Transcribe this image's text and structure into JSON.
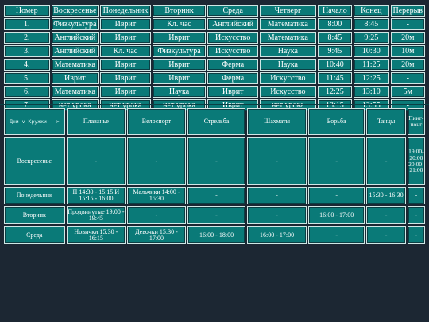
{
  "schedule": {
    "headers": [
      "Номер",
      "Воскресенье",
      "Понедельник",
      "Вторник",
      "Среда",
      "Четверг",
      "Начало",
      "Конец",
      "Перерыв"
    ],
    "rows": [
      [
        "1.",
        "Физкультура",
        "Иврит",
        "Кл. час",
        "Английский",
        "Математика",
        "8:00",
        "8:45",
        "-"
      ],
      [
        "2.",
        "Английский",
        "Иврит",
        "Иврит",
        "Искусство",
        "Математика",
        "8:45",
        "9:25",
        "20м"
      ],
      [
        "3.",
        "Английский",
        "Кл. час",
        "Физкультура",
        "Искусство",
        "Наука",
        "9:45",
        "10:30",
        "10м"
      ],
      [
        "4.",
        "Математика",
        "Иврит",
        "Иврит",
        "Ферма",
        "Наука",
        "10:40",
        "11:25",
        "20м"
      ],
      [
        "5.",
        "Иврит",
        "Иврит",
        "Иврит",
        "Ферма",
        "Искусство",
        "11:45",
        "12:25",
        "-"
      ],
      [
        "6.",
        "Математика",
        "Иврит",
        "Наука",
        "Иврит",
        "Искусство",
        "12:25",
        "13:10",
        "5м"
      ],
      [
        "7.",
        "нет урока",
        "нет урока",
        "нет урока",
        "Иврит",
        "нет урока",
        "13:15",
        "13:55",
        "-"
      ]
    ]
  },
  "clubs": {
    "corner": "Дни v Кружки -->",
    "headers": [
      "Плаванье",
      "Велоспорт",
      "Стрельба",
      "Шахматы",
      "Борьба",
      "Танцы",
      "Пинг-понг"
    ],
    "rows": [
      {
        "day": "Воскресенье",
        "cells": [
          "-",
          "-",
          "-",
          "-",
          "-",
          "-",
          "19:00-20:00 20:00-21:00"
        ]
      },
      {
        "day": "Понедельник",
        "cells": [
          "П 14:30 - 15:15 И 15:15 - 16:00",
          "Мальчики 14:00 - 15:30",
          "-",
          "-",
          "-",
          "15:30 - 16:30",
          "-"
        ]
      },
      {
        "day": "Вторник",
        "cells": [
          "Продвинутые 19:00 - 19:45",
          "-",
          "-",
          "-",
          "16:00 - 17:00",
          "-",
          "-"
        ]
      },
      {
        "day": "Среда",
        "cells": [
          "Новички 15:30 - 16:15",
          "Девочки 15:30 - 17:00",
          "16:00 - 18:00",
          "16:00 - 17:00",
          "-",
          "-",
          "-"
        ]
      }
    ]
  },
  "colors": {
    "cell": "#0a7a78",
    "background": "#1c2733",
    "border": "#cfe7e5"
  }
}
